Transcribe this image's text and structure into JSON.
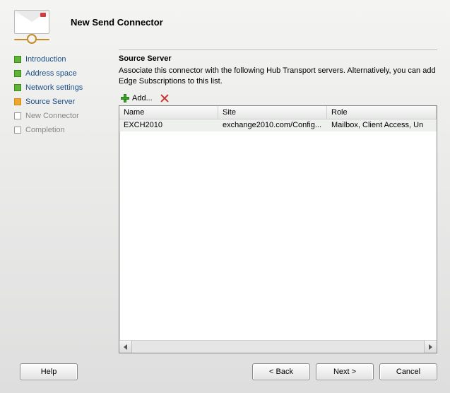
{
  "header": {
    "title": "New Send Connector"
  },
  "sidebar": {
    "items": [
      {
        "label": "Introduction",
        "state": "done"
      },
      {
        "label": "Address space",
        "state": "done"
      },
      {
        "label": "Network settings",
        "state": "done"
      },
      {
        "label": "Source Server",
        "state": "current"
      },
      {
        "label": "New Connector",
        "state": "future"
      },
      {
        "label": "Completion",
        "state": "future"
      }
    ]
  },
  "main": {
    "title": "Source Server",
    "description": "Associate this connector with the following Hub Transport servers. Alternatively, you can add Edge Subscriptions to this list.",
    "toolbar": {
      "add_label": "Add..."
    },
    "columns": {
      "name": "Name",
      "site": "Site",
      "role": "Role"
    },
    "rows": [
      {
        "name": "EXCH2010",
        "site": "exchange2010.com/Config...",
        "role": "Mailbox, Client Access, Un"
      }
    ]
  },
  "footer": {
    "help": "Help",
    "back": "< Back",
    "next": "Next >",
    "cancel": "Cancel"
  }
}
